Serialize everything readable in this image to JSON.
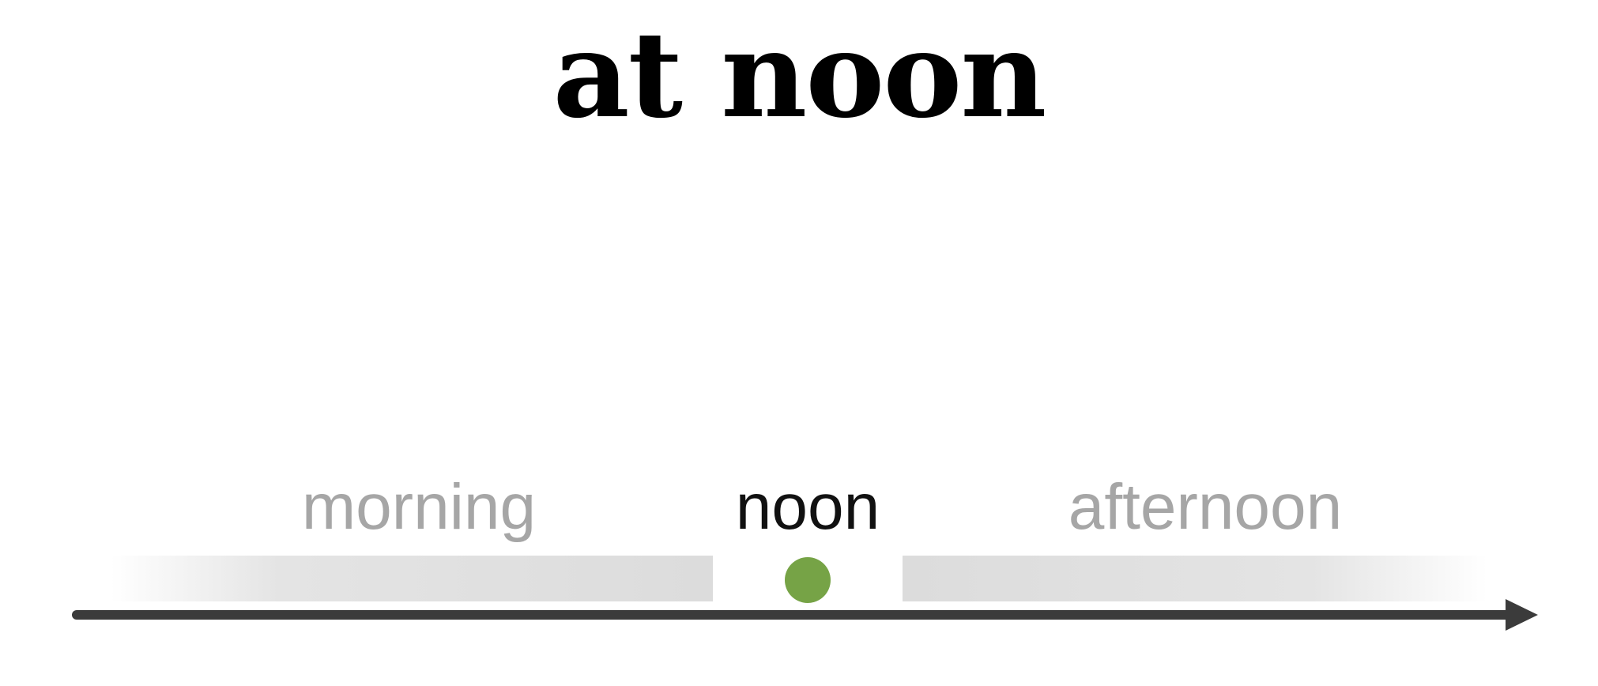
{
  "title": "at noon",
  "timeline": {
    "segments": [
      {
        "label": "morning",
        "state": "inactive"
      },
      {
        "label": "noon",
        "state": "active"
      },
      {
        "label": "afternoon",
        "state": "inactive"
      }
    ],
    "marker": "noon"
  },
  "colors": {
    "title": "#000000",
    "active_label": "#111111",
    "inactive_label": "#a6a6a6",
    "band": "#dcdcdc",
    "marker": "#76a346",
    "axis": "#3b3b3b"
  },
  "icons": {
    "marker": "dot-icon",
    "axis_end": "arrowhead-icon"
  }
}
